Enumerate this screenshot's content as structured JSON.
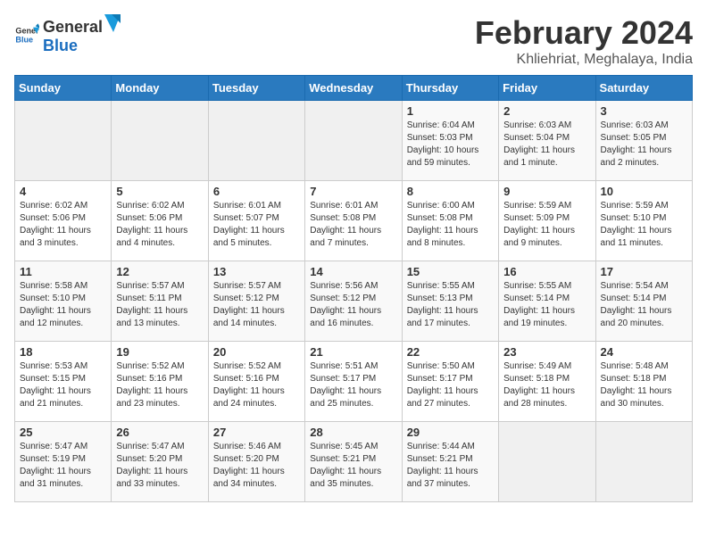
{
  "header": {
    "logo_general": "General",
    "logo_blue": "Blue",
    "title": "February 2024",
    "subtitle": "Khliehriat, Meghalaya, India"
  },
  "weekdays": [
    "Sunday",
    "Monday",
    "Tuesday",
    "Wednesday",
    "Thursday",
    "Friday",
    "Saturday"
  ],
  "weeks": [
    [
      {
        "day": "",
        "info": ""
      },
      {
        "day": "",
        "info": ""
      },
      {
        "day": "",
        "info": ""
      },
      {
        "day": "",
        "info": ""
      },
      {
        "day": "1",
        "info": "Sunrise: 6:04 AM\nSunset: 5:03 PM\nDaylight: 10 hours\nand 59 minutes."
      },
      {
        "day": "2",
        "info": "Sunrise: 6:03 AM\nSunset: 5:04 PM\nDaylight: 11 hours\nand 1 minute."
      },
      {
        "day": "3",
        "info": "Sunrise: 6:03 AM\nSunset: 5:05 PM\nDaylight: 11 hours\nand 2 minutes."
      }
    ],
    [
      {
        "day": "4",
        "info": "Sunrise: 6:02 AM\nSunset: 5:06 PM\nDaylight: 11 hours\nand 3 minutes."
      },
      {
        "day": "5",
        "info": "Sunrise: 6:02 AM\nSunset: 5:06 PM\nDaylight: 11 hours\nand 4 minutes."
      },
      {
        "day": "6",
        "info": "Sunrise: 6:01 AM\nSunset: 5:07 PM\nDaylight: 11 hours\nand 5 minutes."
      },
      {
        "day": "7",
        "info": "Sunrise: 6:01 AM\nSunset: 5:08 PM\nDaylight: 11 hours\nand 7 minutes."
      },
      {
        "day": "8",
        "info": "Sunrise: 6:00 AM\nSunset: 5:08 PM\nDaylight: 11 hours\nand 8 minutes."
      },
      {
        "day": "9",
        "info": "Sunrise: 5:59 AM\nSunset: 5:09 PM\nDaylight: 11 hours\nand 9 minutes."
      },
      {
        "day": "10",
        "info": "Sunrise: 5:59 AM\nSunset: 5:10 PM\nDaylight: 11 hours\nand 11 minutes."
      }
    ],
    [
      {
        "day": "11",
        "info": "Sunrise: 5:58 AM\nSunset: 5:10 PM\nDaylight: 11 hours\nand 12 minutes."
      },
      {
        "day": "12",
        "info": "Sunrise: 5:57 AM\nSunset: 5:11 PM\nDaylight: 11 hours\nand 13 minutes."
      },
      {
        "day": "13",
        "info": "Sunrise: 5:57 AM\nSunset: 5:12 PM\nDaylight: 11 hours\nand 14 minutes."
      },
      {
        "day": "14",
        "info": "Sunrise: 5:56 AM\nSunset: 5:12 PM\nDaylight: 11 hours\nand 16 minutes."
      },
      {
        "day": "15",
        "info": "Sunrise: 5:55 AM\nSunset: 5:13 PM\nDaylight: 11 hours\nand 17 minutes."
      },
      {
        "day": "16",
        "info": "Sunrise: 5:55 AM\nSunset: 5:14 PM\nDaylight: 11 hours\nand 19 minutes."
      },
      {
        "day": "17",
        "info": "Sunrise: 5:54 AM\nSunset: 5:14 PM\nDaylight: 11 hours\nand 20 minutes."
      }
    ],
    [
      {
        "day": "18",
        "info": "Sunrise: 5:53 AM\nSunset: 5:15 PM\nDaylight: 11 hours\nand 21 minutes."
      },
      {
        "day": "19",
        "info": "Sunrise: 5:52 AM\nSunset: 5:16 PM\nDaylight: 11 hours\nand 23 minutes."
      },
      {
        "day": "20",
        "info": "Sunrise: 5:52 AM\nSunset: 5:16 PM\nDaylight: 11 hours\nand 24 minutes."
      },
      {
        "day": "21",
        "info": "Sunrise: 5:51 AM\nSunset: 5:17 PM\nDaylight: 11 hours\nand 25 minutes."
      },
      {
        "day": "22",
        "info": "Sunrise: 5:50 AM\nSunset: 5:17 PM\nDaylight: 11 hours\nand 27 minutes."
      },
      {
        "day": "23",
        "info": "Sunrise: 5:49 AM\nSunset: 5:18 PM\nDaylight: 11 hours\nand 28 minutes."
      },
      {
        "day": "24",
        "info": "Sunrise: 5:48 AM\nSunset: 5:18 PM\nDaylight: 11 hours\nand 30 minutes."
      }
    ],
    [
      {
        "day": "25",
        "info": "Sunrise: 5:47 AM\nSunset: 5:19 PM\nDaylight: 11 hours\nand 31 minutes."
      },
      {
        "day": "26",
        "info": "Sunrise: 5:47 AM\nSunset: 5:20 PM\nDaylight: 11 hours\nand 33 minutes."
      },
      {
        "day": "27",
        "info": "Sunrise: 5:46 AM\nSunset: 5:20 PM\nDaylight: 11 hours\nand 34 minutes."
      },
      {
        "day": "28",
        "info": "Sunrise: 5:45 AM\nSunset: 5:21 PM\nDaylight: 11 hours\nand 35 minutes."
      },
      {
        "day": "29",
        "info": "Sunrise: 5:44 AM\nSunset: 5:21 PM\nDaylight: 11 hours\nand 37 minutes."
      },
      {
        "day": "",
        "info": ""
      },
      {
        "day": "",
        "info": ""
      }
    ]
  ]
}
